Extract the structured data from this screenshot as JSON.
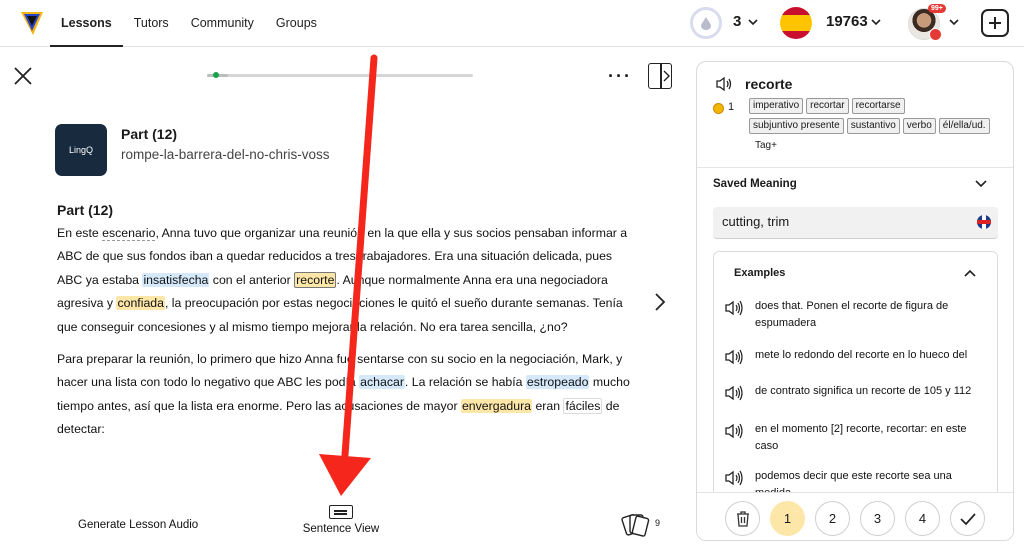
{
  "nav": {
    "items": [
      {
        "label": "Lessons",
        "active": true
      },
      {
        "label": "Tutors",
        "active": false
      },
      {
        "label": "Community",
        "active": false
      },
      {
        "label": "Groups",
        "active": false
      }
    ]
  },
  "header": {
    "streak": "3",
    "language_flag": "spain-flag",
    "coins": "19763",
    "notifications_badge": "99+"
  },
  "lesson": {
    "cover_text": "LingQ",
    "title": "Part (12)",
    "slug": "rompe-la-barrera-del-no-chris-voss",
    "heading": "Part (12)",
    "progress": 0.08
  },
  "reader": {
    "p1": [
      {
        "t": "En este "
      },
      {
        "t": "escenario",
        "s": "dot"
      },
      {
        "t": ", Anna tuvo que organizar una reunión en la que ella y sus socios pensaban informar a ABC de que sus fondos iban a quedar reducidos a tres trabajadores.  Era una situación delicada, pues ABC ya estaba "
      },
      {
        "t": "insatisfecha",
        "s": "blue"
      },
      {
        "t": " con el anterior "
      },
      {
        "t": "recorte",
        "s": "sel"
      },
      {
        "t": ".  Aunque normalmente Anna era una negociadora agresiva y "
      },
      {
        "t": "confiada",
        "s": "yellow"
      },
      {
        "t": ", la preocupación por estas negociaciones le quitó el sueño durante semanas.  Tenía que conseguir concesiones y al mismo tiempo mejorar la relación.  No era tarea sencilla, ¿no?"
      }
    ],
    "p2": [
      {
        "t": "Para preparar la reunión, lo primero que hizo Anna fue sentarse con su socio en la negociación, Mark, y hacer una lista con todo lo negativo que ABC les podía "
      },
      {
        "t": "achacar",
        "s": "blue"
      },
      {
        "t": ".  La relación se había "
      },
      {
        "t": "estropeado",
        "s": "blue"
      },
      {
        "t": " mucho tiempo antes, así que la lista era enorme.  Pero las acusaciones de mayor "
      },
      {
        "t": "envergadura",
        "s": "yellow"
      },
      {
        "t": " eran "
      },
      {
        "t": "fáciles",
        "s": "box"
      },
      {
        "t": " de detectar:"
      }
    ]
  },
  "footer": {
    "generate_audio": "Generate Lesson Audio",
    "sentence_view": "Sentence View",
    "cards_count": "9"
  },
  "panel": {
    "term": "recorte",
    "level": "1",
    "tags": [
      "imperativo",
      "recortar",
      "recortarse",
      "subjuntivo presente",
      "sustantivo",
      "verbo",
      "él/ella/ud."
    ],
    "tag_add": "Tag+",
    "saved_meaning_label": "Saved Meaning",
    "meaning": "cutting, trim",
    "examples_label": "Examples",
    "examples": [
      "does that. Ponen el recorte de figura de espumadera",
      "mete lo redondo del recorte en lo hueco del",
      "de contrato significa un recorte de 105 y 112",
      "en el momento [2] recorte, recortar: en este caso",
      "podemos decir que este recorte sea una medida"
    ],
    "srs": [
      "1",
      "2",
      "3",
      "4"
    ],
    "srs_active": "1"
  },
  "colors": {
    "known_blue": "#d5e9fb",
    "lingq_yellow": "#fde7a8",
    "arrow_red": "#f5261b",
    "progress_green": "#17a34a"
  }
}
